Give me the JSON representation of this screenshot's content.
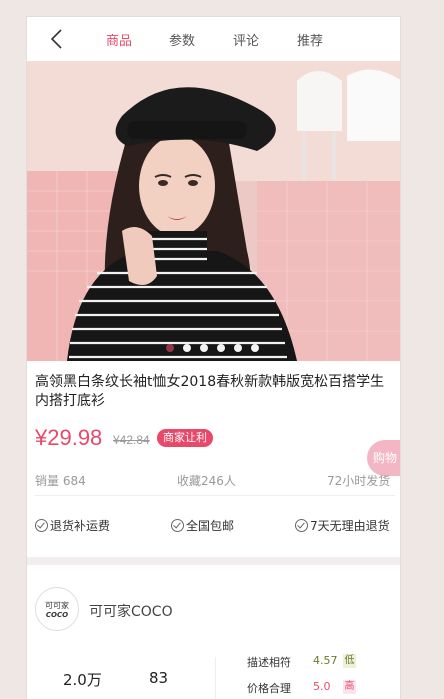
{
  "header": {
    "tabs": [
      {
        "label": "商品",
        "active": true
      },
      {
        "label": "参数",
        "active": false
      },
      {
        "label": "评论",
        "active": false
      },
      {
        "label": "推荐",
        "active": false
      }
    ]
  },
  "gallery": {
    "dot_count": 6,
    "active_index": 0
  },
  "product": {
    "title": "高领黑白条纹长袖t恤女2018春秋新款韩版宽松百搭学生内搭打底衫",
    "price": "¥29.98",
    "old_price": "¥42.84",
    "badge": "商家让利",
    "float_button": "购物"
  },
  "stats": {
    "sales": "销量 684",
    "favorites": "收藏246人",
    "shipping": "72小时发货"
  },
  "services": [
    "退货补运费",
    "全国包邮",
    "7天无理由退货"
  ],
  "shop": {
    "logo_top": "可可家",
    "logo_bottom": "COCO",
    "name": "可可家COCO",
    "stat1": "2.0万",
    "stat2": "83",
    "scores": [
      {
        "label": "描述相符",
        "value": "4.57",
        "tag": "低",
        "tag_color": "#6b7a2c"
      },
      {
        "label": "价格合理",
        "value": "5.0",
        "tag": "高",
        "tag_color": "#e8496a"
      }
    ]
  },
  "colors": {
    "accent": "#e8496a",
    "page_bg": "#efe7e3"
  }
}
